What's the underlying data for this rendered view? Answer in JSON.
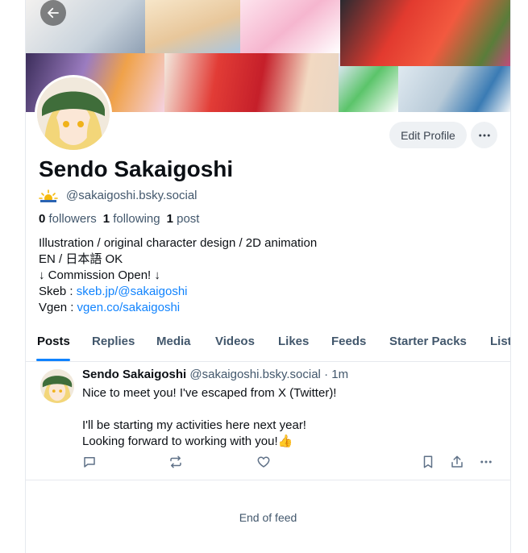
{
  "profile": {
    "display_name": "Sendo Sakaigoshi",
    "handle": "@sakaigoshi.bsky.social",
    "followers_count": "0",
    "followers_label": "followers",
    "following_count": "1",
    "following_label": "following",
    "posts_count": "1",
    "posts_label": "post",
    "edit_label": "Edit Profile",
    "bio": {
      "line1": "Illustration / original character design / 2D animation",
      "line2": "EN / 日本語 OK",
      "line3": "↓ Commission Open! ↓",
      "skeb_label": "Skeb : ",
      "skeb_link": "skeb.jp/@sakaigoshi",
      "vgen_label": "Vgen : ",
      "vgen_link": "vgen.co/sakaigoshi"
    },
    "handle_icon": "sun-cloud-emoji"
  },
  "tabs": [
    "Posts",
    "Replies",
    "Media",
    "Videos",
    "Likes",
    "Feeds",
    "Starter Packs",
    "Lists"
  ],
  "active_tab": "Posts",
  "post": {
    "author_name": "Sendo Sakaigoshi",
    "author_handle": "@sakaigoshi.bsky.social",
    "time": "· 1m",
    "text": "Nice to meet you! I've escaped from X (Twitter)!\n\nI'll be starting my activities here next year!\nLooking forward to working with you!👍"
  },
  "feed_end": "End of feed",
  "colors": {
    "accent": "#1083fe",
    "muted": "#42576c",
    "border": "#e6e9ee",
    "button_bg": "#eef1f4"
  },
  "icons": [
    "back-arrow-icon",
    "more-horizontal-icon",
    "reply-icon",
    "repost-icon",
    "like-icon",
    "bookmark-icon",
    "share-icon"
  ]
}
